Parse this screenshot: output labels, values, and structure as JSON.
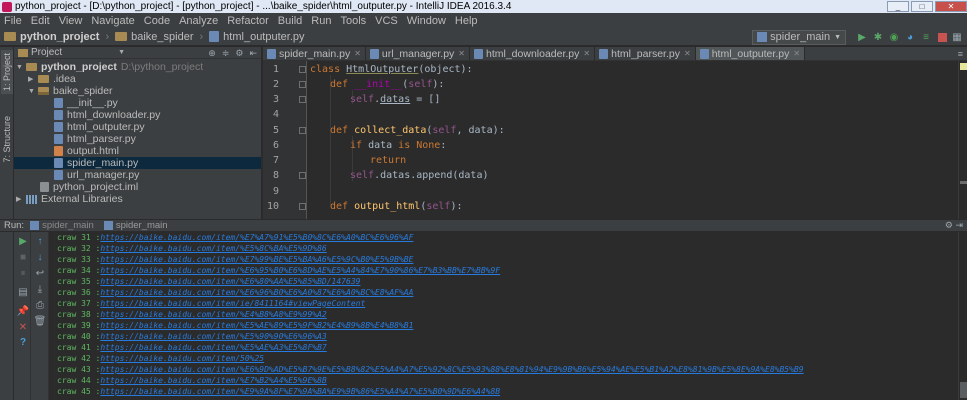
{
  "window": {
    "title": "python_project - [D:\\python_project] - [python_project] - ...\\baike_spider\\html_outputer.py - IntelliJ IDEA 2016.3.4"
  },
  "menu": [
    "File",
    "Edit",
    "View",
    "Navigate",
    "Code",
    "Analyze",
    "Refactor",
    "Build",
    "Run",
    "Tools",
    "VCS",
    "Window",
    "Help"
  ],
  "breadcrumbs": [
    "python_project",
    "baike_spider",
    "html_outputer.py"
  ],
  "run_config": "spider_main",
  "project_panel": {
    "label": "Project",
    "tree": [
      {
        "label": "python_project",
        "hint": "D:\\python_project",
        "kind": "folder",
        "level": 0,
        "open": true
      },
      {
        "label": ".idea",
        "kind": "folder",
        "level": 1,
        "open": false
      },
      {
        "label": "baike_spider",
        "kind": "package",
        "level": 1,
        "open": true
      },
      {
        "label": "__init__.py",
        "kind": "py",
        "level": 2
      },
      {
        "label": "html_downloader.py",
        "kind": "py",
        "level": 2
      },
      {
        "label": "html_outputer.py",
        "kind": "py",
        "level": 2
      },
      {
        "label": "html_parser.py",
        "kind": "py",
        "level": 2
      },
      {
        "label": "output.html",
        "kind": "html",
        "level": 2
      },
      {
        "label": "spider_main.py",
        "kind": "py",
        "level": 2,
        "selected": true
      },
      {
        "label": "url_manager.py",
        "kind": "py",
        "level": 2
      },
      {
        "label": "python_project.iml",
        "kind": "iml",
        "level": 1
      },
      {
        "label": "External Libraries",
        "kind": "lib",
        "level": 0,
        "open": false
      }
    ]
  },
  "stripe": {
    "project": "1: Project",
    "structure": "7: Structure"
  },
  "editor_tabs": [
    {
      "label": "spider_main.py",
      "active": false
    },
    {
      "label": "url_manager.py",
      "active": false
    },
    {
      "label": "html_downloader.py",
      "active": false
    },
    {
      "label": "html_parser.py",
      "active": false
    },
    {
      "label": "html_outputer.py",
      "active": true
    }
  ],
  "code_lines": [
    "1",
    "2",
    "3",
    "4",
    "5",
    "6",
    "7",
    "8",
    "9",
    "10"
  ],
  "run_panel": {
    "label": "Run:",
    "tabs": [
      "spider_main",
      "spider_main"
    ]
  },
  "console": [
    {
      "label": "craw 31 : ",
      "url": "https://baike.baidu.com/item/%E7%A7%91%E5%B0%8C%E6%A0%BC%E6%96%AF"
    },
    {
      "label": "craw 32 : ",
      "url": "https://baike.baidu.com/item/%E5%8C%BA%E5%9D%86"
    },
    {
      "label": "craw 33 : ",
      "url": "https://baike.baidu.com/item/%E7%99%BE%E5%BA%A6%E5%9C%B0%E5%9B%BE"
    },
    {
      "label": "craw 34 : ",
      "url": "https://baike.baidu.com/item/%E6%95%B0%E6%8D%AE%E5%A4%84%E7%90%86%E7%B3%BB%E7%BB%9F"
    },
    {
      "label": "craw 35 : ",
      "url": "https://baike.baidu.com/item/%E6%80%AA%E5%85%BD/147639"
    },
    {
      "label": "craw 36 : ",
      "url": "https://baike.baidu.com/item/%E6%96%B0%E6%A0%87%E6%A0%BC%E8%AF%AA"
    },
    {
      "label": "craw 37 : ",
      "url": "https://baike.baidu.com/item/ie/8411164#viewPageContent"
    },
    {
      "label": "craw 38 : ",
      "url": "https://baike.baidu.com/item/%E4%B8%A8%E9%99%A2"
    },
    {
      "label": "craw 39 : ",
      "url": "https://baike.baidu.com/item/%E5%AE%89%E5%9F%B2%E4%B9%8B%E4%B8%B1"
    },
    {
      "label": "craw 40 : ",
      "url": "https://baike.baidu.com/item/%E5%90%90%E6%96%A3"
    },
    {
      "label": "craw 41 : ",
      "url": "https://baike.baidu.com/item/%E5%AE%A3%E5%8F%B7"
    },
    {
      "label": "craw 42 : ",
      "url": "https://baike.baidu.com/item/50%25"
    },
    {
      "label": "craw 43 : ",
      "url": "https://baike.baidu.com/item/%E6%9D%AD%E5%B7%9E%E5%B8%82%E5%A4%A7%E5%92%8C%E5%93%88%E8%81%94%E9%9B%B6%E5%94%AE%E5%B1%A2%E8%81%9B%E5%8E%9A%E8%B5%B9"
    },
    {
      "label": "craw 44 : ",
      "url": "https://baike.baidu.com/item/%E7%B2%A4%E5%9E%8B"
    },
    {
      "label": "craw 45 : ",
      "url": "https://baike.baidu.com/item/%E9%9A%8F%E7%9A%BA%E9%9B%86%E5%A4%A7%E5%B0%9D%E6%A4%8B"
    }
  ]
}
